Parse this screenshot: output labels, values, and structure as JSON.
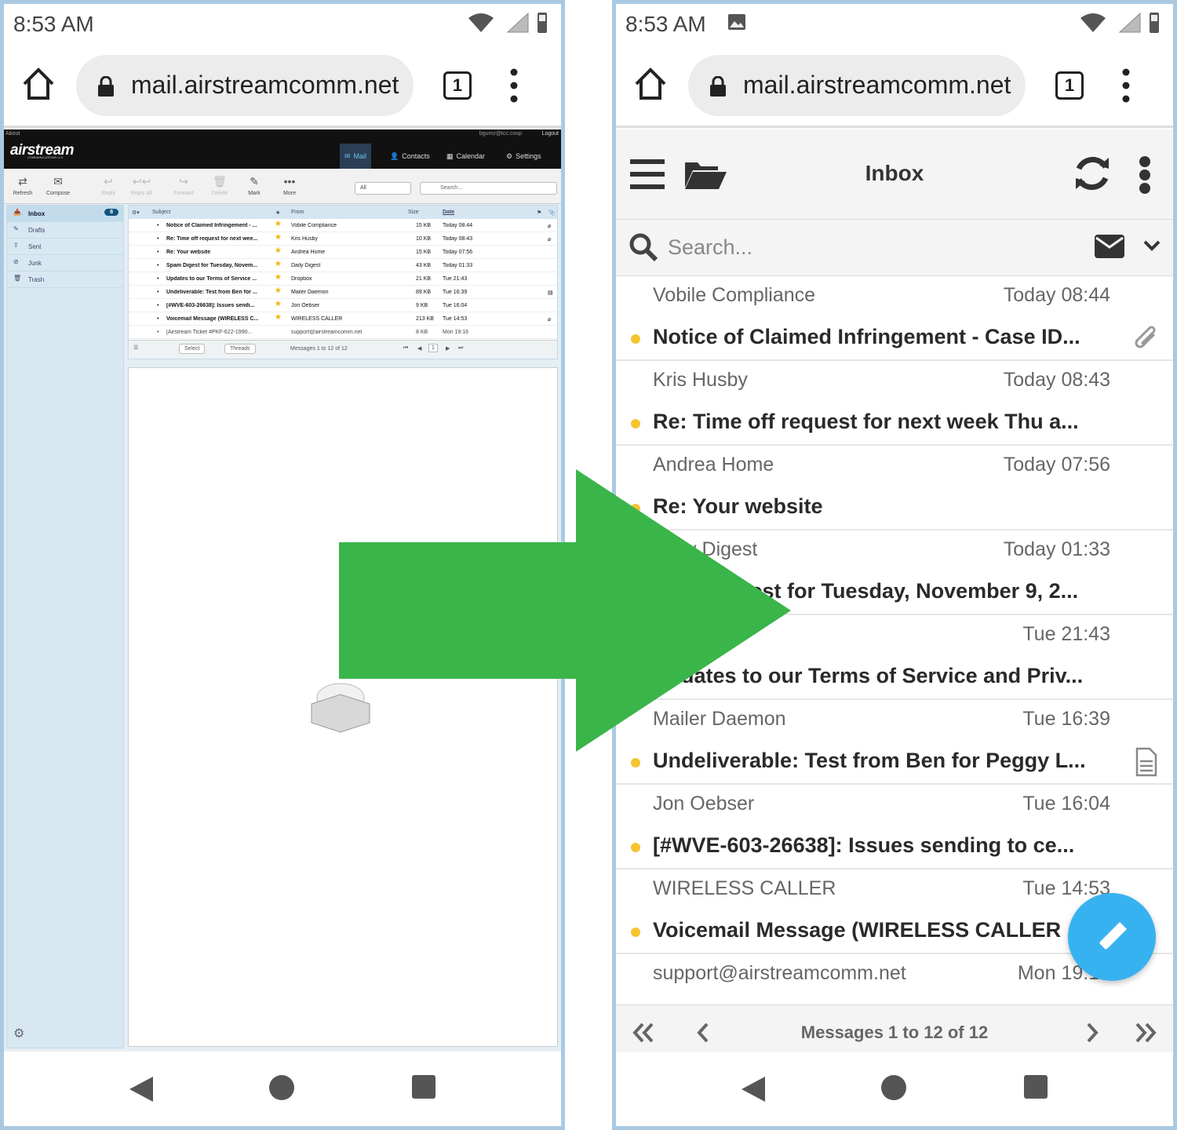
{
  "status_bar": {
    "time": "8:53 AM"
  },
  "browser": {
    "url": "mail.airstreamcomm.net",
    "tab_count": "1"
  },
  "left": {
    "top": {
      "about": "About",
      "user": "bgumz@tcc.coop",
      "logout": "Logout",
      "logo": "airstream",
      "logo_sub": "COMMUNICATIONS LLC"
    },
    "tabs": [
      "Mail",
      "Contacts",
      "Calendar",
      "Settings"
    ],
    "toolbar": [
      "Refresh",
      "Compose",
      "Reply",
      "Reply all",
      "Forward",
      "Delete",
      "Mark",
      "More"
    ],
    "filter": "All",
    "search_placeholder": "Search...",
    "folders": [
      {
        "label": "Inbox",
        "count": "8"
      },
      {
        "label": "Drafts"
      },
      {
        "label": "Sent"
      },
      {
        "label": "Junk"
      },
      {
        "label": "Trash"
      }
    ],
    "columns": {
      "subject": "Subject",
      "from": "From",
      "size": "Size",
      "date": "Date"
    },
    "rows": [
      {
        "subject": "Notice of Claimed Infringement - ...",
        "from": "Vobile Compliance",
        "size": "15 KB",
        "date": "Today 08:44"
      },
      {
        "subject": "Re: Time off request for next wee...",
        "from": "Kris Husby",
        "size": "10 KB",
        "date": "Today 08:43"
      },
      {
        "subject": "Re: Your website",
        "from": "Andrea Home",
        "size": "15 KB",
        "date": "Today 07:56"
      },
      {
        "subject": "Spam Digest for Tuesday, Novem...",
        "from": "Daily Digest",
        "size": "43 KB",
        "date": "Today 01:33"
      },
      {
        "subject": "Updates to our Terms of Service ...",
        "from": "Dropbox",
        "size": "21 KB",
        "date": "Tue 21:43"
      },
      {
        "subject": "Undeliverable: Test from Ben for ...",
        "from": "Mailer Daemon",
        "size": "89 KB",
        "date": "Tue 16:39"
      },
      {
        "subject": "[#WVE-603-26638]: Issues sendi...",
        "from": "Jon Oebser",
        "size": "9 KB",
        "date": "Tue 16:04"
      },
      {
        "subject": "Voicemail Message (WIRELESS C...",
        "from": "WIRELESS CALLER",
        "size": "213 KB",
        "date": "Tue 14:53"
      },
      {
        "subject": "[Airstream Ticket #PKF-622-1990...",
        "from": "support@airstreamcomm.net",
        "size": "8 KB",
        "date": "Mon 19:16"
      }
    ],
    "footer": {
      "select": "Select",
      "threads": "Threads",
      "count": "Messages 1 to 12 of 12",
      "page": "1"
    }
  },
  "right": {
    "title": "Inbox",
    "search_placeholder": "Search...",
    "messages": [
      {
        "from": "Vobile Compliance",
        "date": "Today 08:44",
        "subject": "Notice of Claimed Infringement - Case ID...",
        "icon": "paperclip-icon"
      },
      {
        "from": "Kris Husby",
        "date": "Today 08:43",
        "subject": "Re: Time off request for next week Thu a..."
      },
      {
        "from": "Andrea Home",
        "date": "Today 07:56",
        "subject": "Re: Your website"
      },
      {
        "from": "Daily Digest",
        "date": "Today 01:33",
        "subject": "Spam Digest for Tuesday, November 9, 2..."
      },
      {
        "from": "Dropbox",
        "date": "Tue 21:43",
        "subject": "Updates to our Terms of Service and Priv..."
      },
      {
        "from": "Mailer Daemon",
        "date": "Tue 16:39",
        "subject": "Undeliverable: Test from Ben for Peggy L...",
        "icon": "document-icon"
      },
      {
        "from": "Jon Oebser",
        "date": "Tue 16:04",
        "subject": "[#WVE-603-26638]: Issues sending to ce..."
      },
      {
        "from": "WIRELESS CALLER",
        "date": "Tue 14:53",
        "subject": "Voicemail Message (WIRELESS CALLER ..."
      },
      {
        "from": "support@airstreamcomm.net",
        "date": "Mon 19:16",
        "subject": ""
      }
    ],
    "footer": {
      "count": "Messages 1 to 12 of 12"
    }
  },
  "colors": {
    "accent_green": "#3ab54a",
    "fab_blue": "#37b2f0",
    "unread_dot": "#f4c430",
    "roundcube_dark": "#111111"
  }
}
